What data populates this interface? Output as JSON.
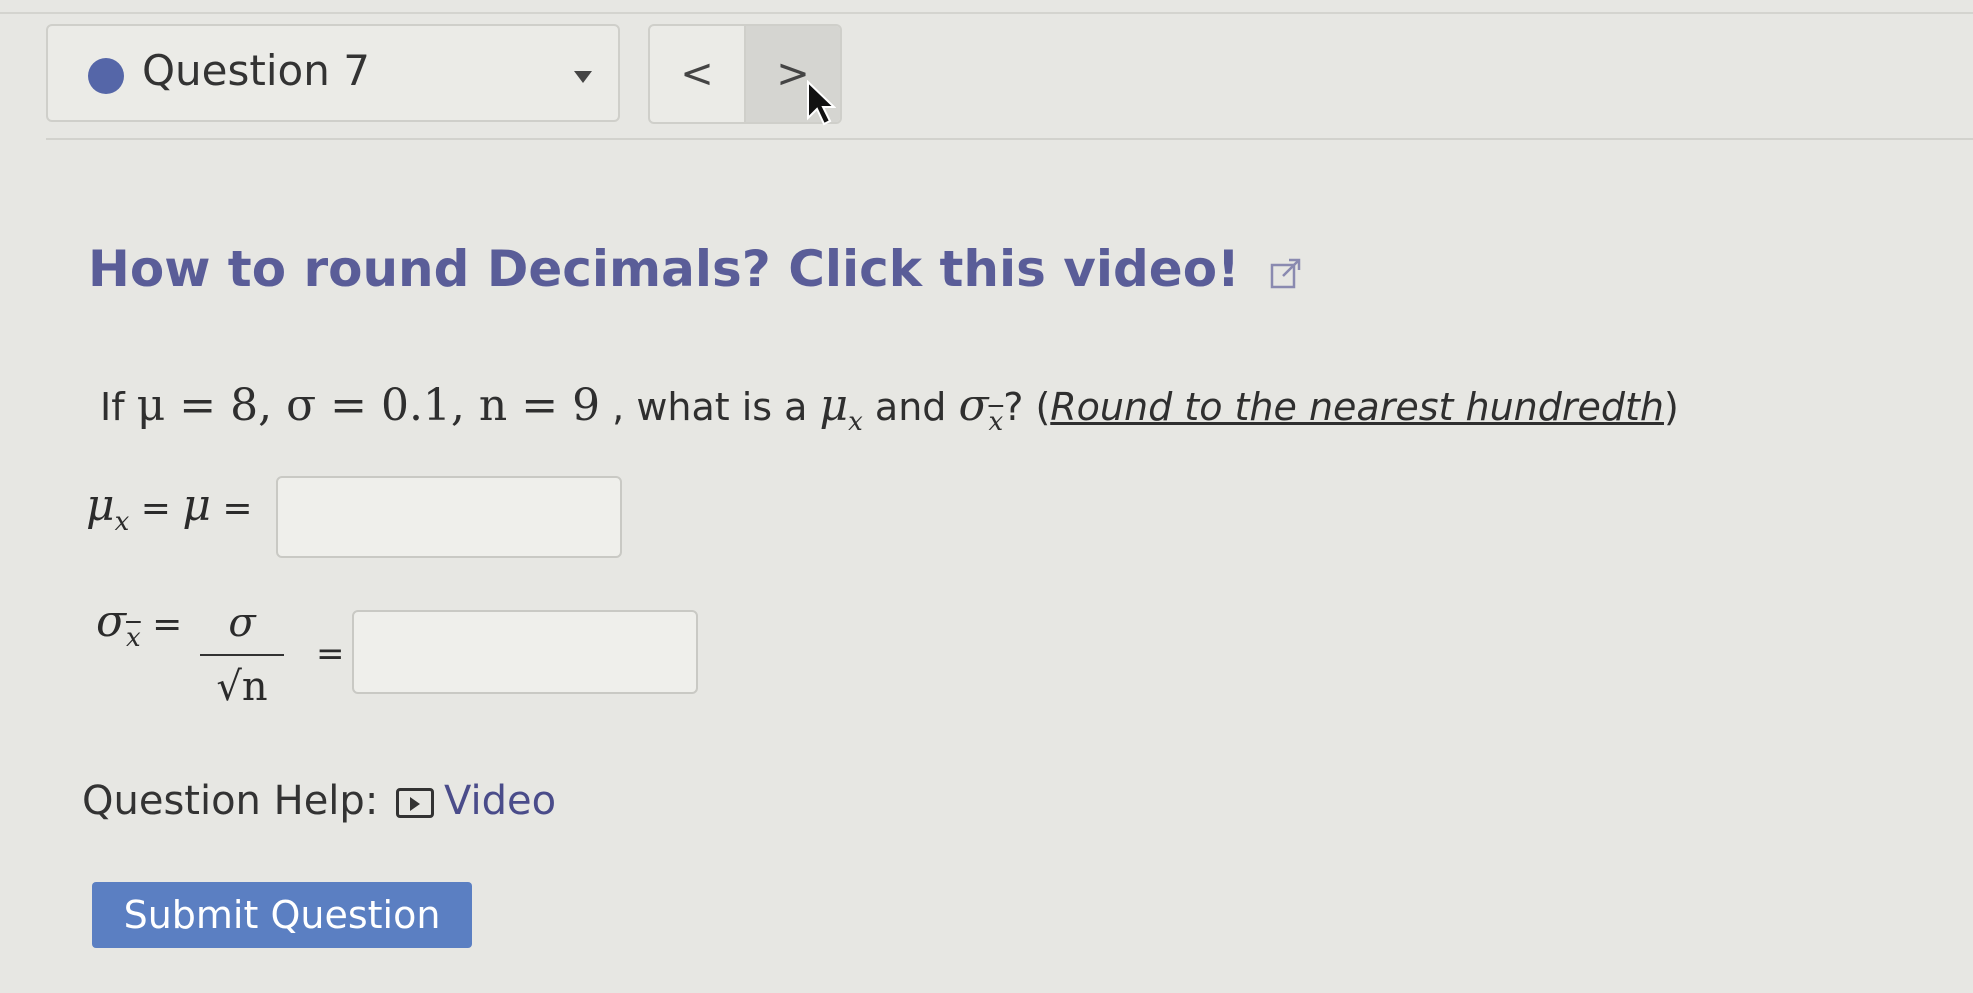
{
  "header": {
    "question_label": "Question 7",
    "prev_label": "<",
    "next_label": ">"
  },
  "content": {
    "video_link": "How to round Decimals? Click this video!",
    "question": {
      "part1": "If ",
      "given": "μ = 8, σ = 0.1, n = 9",
      "part2": " , what is a ",
      "mu": "μ",
      "x": "x",
      "part3": " and ",
      "sigma": "σ",
      "xbar": "x",
      "part4": "? (",
      "round_note": "Round to the nearest hundredth",
      "part5": ")"
    },
    "row1": {
      "lhs_mu": "μ",
      "lhs_x": "x",
      "eq": " = ",
      "mu": "μ",
      "eq2": " ="
    },
    "row2": {
      "sigma": "σ",
      "xbar": "x",
      "eq": " =",
      "num": "σ",
      "den": "√n",
      "eq2": "="
    },
    "answer1": "",
    "answer2": ""
  },
  "help": {
    "label": "Question Help:",
    "video": "Video"
  },
  "submit_label": "Submit Question",
  "colors": {
    "accent": "#5566a8",
    "link": "#5a5d98",
    "submit": "#5b7fc2"
  }
}
